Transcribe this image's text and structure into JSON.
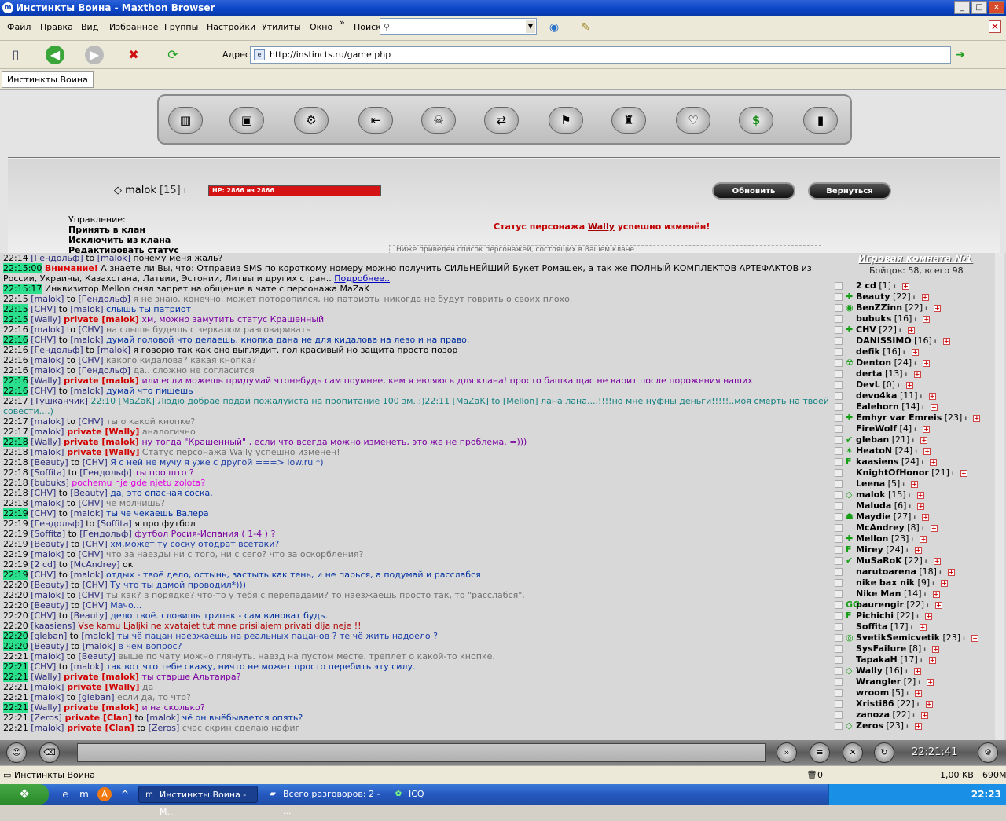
{
  "window": {
    "title": "Инстинкты Воина - Maxthon Browser",
    "buttons": [
      "_",
      "□",
      "×"
    ]
  },
  "menu": {
    "items": [
      "Файл",
      "Правка",
      "Вид",
      "Избранное",
      "Группы",
      "Настройки",
      "Утилиты",
      "Окно"
    ],
    "more": "»",
    "search_label": "Поиск",
    "search_value": ""
  },
  "toolbar": {
    "address_label": "Адрес",
    "url": "http://instincts.ru/game.php"
  },
  "tabs": [
    {
      "label": "Инстинкты Воина"
    }
  ],
  "game": {
    "player_name": "malok",
    "player_level": "[15]",
    "hp_text": "HP: 2866 из 2866",
    "hp_fraction": 1.0,
    "refresh_button": "Обновить",
    "back_button": "Вернуться",
    "management": {
      "title": "Управление:",
      "items": [
        "Принять в клан",
        "Исключить из клана",
        "Редактировать статус"
      ]
    },
    "status": {
      "before": "Статус персонажа ",
      "name": "Wally",
      "after": " успешно изменён!"
    },
    "hint": "Ниже приведен список персонажей, состоящих в Вашем клане"
  },
  "chat": [
    {
      "t": "22:14",
      "hl": false,
      "nick": "[Гендольф]",
      "to": " to ",
      "target": "[malok]",
      "msg": " почему меня жаль?",
      "c": "m-dark"
    },
    {
      "t": "22:15:00",
      "hl": true,
      "warn": "Внимание!",
      "msg": " А знаете ли Вы, что: Отправив SMS по короткому номеру можно получить СИЛЬНЕЙШИЙ Букет Ромашек, а так же ПОЛНЫЙ КОМПЛЕКТОВ АРТЕФАКТОВ из России, Украины, Казахстана, Латвии, Эстонии, Литвы и других стран.. ",
      "link": "Подробнее..",
      "c": "m-dark",
      "wrap": true
    },
    {
      "t": "22:15:17",
      "hl": true,
      "msg": " Инквизитор Mellon снял запрет на общение в чате с персонажа MaZaK",
      "c": "m-dark"
    },
    {
      "t": "22:15",
      "hl": false,
      "nick": "[malok]",
      "to": " to ",
      "target": "[Гендольф]",
      "msg": " я не знаю, конечно. может поторопился, но патриоты никогда не будут говрить о своих плохо.",
      "c": "m-gray"
    },
    {
      "t": "22:15",
      "hl": true,
      "nick": "[CHV]",
      "to": " to ",
      "target": "[malok]",
      "msg": " слышь ты патриот",
      "c": "m-navy"
    },
    {
      "t": "22:15",
      "hl": true,
      "nick": "[Wally]",
      "priv": " private [malok]",
      "msg": " хм, можно замутить статус Крашенный",
      "c": "m-purple"
    },
    {
      "t": "22:16",
      "hl": false,
      "nick": "[malok]",
      "to": " to ",
      "target": "[CHV]",
      "msg": " на слышь будешь с зеркалом разговаривать",
      "c": "m-gray"
    },
    {
      "t": "22:16",
      "hl": true,
      "nick": "[CHV]",
      "to": " to ",
      "target": "[malok]",
      "msg": " думай головой что делаешь. кнопка дана не для кидалова на лево и на право.",
      "c": "m-navy"
    },
    {
      "t": "22:16",
      "hl": false,
      "nick": "[Гендольф]",
      "to": " to ",
      "target": "[malok]",
      "msg": " я говорю так как оно выглядит. гол красивый но защита просто позор",
      "c": "m-dark"
    },
    {
      "t": "22:16",
      "hl": false,
      "nick": "[malok]",
      "to": " to ",
      "target": "[CHV]",
      "msg": " какого кидалова? какая кнопка?",
      "c": "m-gray"
    },
    {
      "t": "22:16",
      "hl": false,
      "nick": "[malok]",
      "to": " to ",
      "target": "[Гендольф]",
      "msg": " да.. сложно не согласится",
      "c": "m-gray"
    },
    {
      "t": "22:16",
      "hl": true,
      "nick": "[Wally]",
      "priv": " private [malok]",
      "msg": " или если можешь придумай чтонебудь сам поумнее, кем я евляюсь для клана! просто башка щас не варит после порожения наших",
      "c": "m-purple"
    },
    {
      "t": "22:16",
      "hl": true,
      "nick": "[CHV]",
      "to": " to ",
      "target": "[malok]",
      "msg": " думай что пишешь",
      "c": "m-navy"
    },
    {
      "t": "22:17",
      "hl": false,
      "nick": "[Тушканчик]",
      "msg": " 22:10 [MaZaK] Людю добрае подай пожалуйста на пропитание 100 зм..:)22:11 [MaZaK] to [Mellon] лана лана....!!!!но мне нуфны деньги!!!!!..моя смерть на твоей совести....)",
      "c": "m-teal",
      "wrap": true
    },
    {
      "t": "22:17",
      "hl": false,
      "nick": "[malok]",
      "to": " to ",
      "target": "[CHV]",
      "msg": " ты о какой кнопке?",
      "c": "m-gray"
    },
    {
      "t": "22:17",
      "hl": false,
      "nick": "[malok]",
      "priv": " private [Wally]",
      "msg": " аналогично",
      "c": "m-gray"
    },
    {
      "t": "22:18",
      "hl": true,
      "nick": "[Wally]",
      "priv": " private [malok]",
      "msg": " ну тогда \"Крашенный\" , если что всегда можно изменеть, это же не проблема. =)))",
      "c": "m-purple"
    },
    {
      "t": "22:18",
      "hl": false,
      "nick": "[malok]",
      "priv": " private [Wally]",
      "msg": " Статус персонажа Wally успешно изменён!",
      "c": "m-gray"
    },
    {
      "t": "22:18",
      "hl": false,
      "nick": "[Beauty]",
      "to": " to ",
      "target": "[CHV]",
      "msg": " Я с ней не мучу я уже с другой ===> Iow.ru *)",
      "c": "m-blue"
    },
    {
      "t": "22:18",
      "hl": false,
      "nick": "[Soffita]",
      "to": " to ",
      "target": "[Гендольф]",
      "msg": " ты про што ?",
      "c": "m-purple"
    },
    {
      "t": "22:18",
      "hl": false,
      "nick": "[bubuks]",
      "msg": " pochemu nje gde njetu zolota?",
      "c": "m-magenta"
    },
    {
      "t": "22:18",
      "hl": false,
      "nick": "[CHV]",
      "to": " to ",
      "target": "[Beauty]",
      "msg": " да, это опасная соска.",
      "c": "m-navy"
    },
    {
      "t": "22:18",
      "hl": false,
      "nick": "[malok]",
      "to": " to ",
      "target": "[CHV]",
      "msg": " че молчишь?",
      "c": "m-gray"
    },
    {
      "t": "22:19",
      "hl": true,
      "nick": "[CHV]",
      "to": " to ",
      "target": "[malok]",
      "msg": " ты че чекаешь Валера",
      "c": "m-navy"
    },
    {
      "t": "22:19",
      "hl": false,
      "nick": "[Гендольф]",
      "to": " to ",
      "target": "[Soffita]",
      "msg": " я про футбол",
      "c": "m-dark"
    },
    {
      "t": "22:19",
      "hl": false,
      "nick": "[Soffita]",
      "to": " to ",
      "target": "[Гендольф]",
      "msg": " футбол Росия-Испания ( 1-4 ) ?",
      "c": "m-purple"
    },
    {
      "t": "22:19",
      "hl": false,
      "nick": "[Beauty]",
      "to": " to ",
      "target": "[CHV]",
      "msg": " хм,может ту соску отодрат всетаки?",
      "c": "m-blue"
    },
    {
      "t": "22:19",
      "hl": false,
      "nick": "[malok]",
      "to": " to ",
      "target": "[CHV]",
      "msg": " что за наезды ни с того, ни с сего? что за оскорбления?",
      "c": "m-gray"
    },
    {
      "t": "22:19",
      "hl": false,
      "nick": "[2 cd]",
      "to": " to ",
      "target": "[McAndrey]",
      "msg": " ок",
      "c": "m-dark"
    },
    {
      "t": "22:19",
      "hl": true,
      "nick": "[CHV]",
      "to": " to ",
      "target": "[malok]",
      "msg": " отдых - твоё дело, остынь, застыть как тень, и не парься, а подумай и расслабся",
      "c": "m-navy"
    },
    {
      "t": "22:20",
      "hl": false,
      "nick": "[Beauty]",
      "to": " to ",
      "target": "[CHV]",
      "msg": " Ту что ты дамой проводил*)))",
      "c": "m-blue"
    },
    {
      "t": "22:20",
      "hl": false,
      "nick": "[malok]",
      "to": " to ",
      "target": "[CHV]",
      "msg": " ты как? в порядке? что-то у тебя с перепадами? то наезжаешь просто так, то \"расслабся\".",
      "c": "m-gray"
    },
    {
      "t": "22:20",
      "hl": false,
      "nick": "[Beauty]",
      "to": " to ",
      "target": "[CHV]",
      "msg": " Мачо...",
      "c": "m-blue"
    },
    {
      "t": "22:20",
      "hl": false,
      "nick": "[CHV]",
      "to": " to ",
      "target": "[Beauty]",
      "msg": " дело твоё. словишь трипак - сам виноват будь.",
      "c": "m-navy"
    },
    {
      "t": "22:20",
      "hl": false,
      "nick": "[kaasiens]",
      "msg": " Vse kamu Ljaljki ne xvatajet tut mne prisilajem privati dlja neje !!",
      "c": "m-red"
    },
    {
      "t": "22:20",
      "hl": true,
      "nick": "[gleban]",
      "to": " to ",
      "target": "[malok]",
      "msg": " ты чё пацан наезжаешь на реальных пацанов ? те чё жить надоело ?",
      "c": "m-blue"
    },
    {
      "t": "22:20",
      "hl": true,
      "nick": "[Beauty]",
      "to": " to ",
      "target": "[malok]",
      "msg": " в чем вопрос?",
      "c": "m-blue"
    },
    {
      "t": "22:21",
      "hl": false,
      "nick": "[malok]",
      "to": " to ",
      "target": "[Beauty]",
      "msg": " выше по чату можно глянуть. наезд на пустом месте. треплет о какой-то кнопке.",
      "c": "m-gray"
    },
    {
      "t": "22:21",
      "hl": true,
      "nick": "[CHV]",
      "to": " to ",
      "target": "[malok]",
      "msg": " так вот что тебе скажу, ничто не может просто перебить эту силу.",
      "c": "m-navy"
    },
    {
      "t": "22:21",
      "hl": true,
      "nick": "[Wally]",
      "priv": " private [malok]",
      "msg": " ты старше Альтаира?",
      "c": "m-purple"
    },
    {
      "t": "22:21",
      "hl": false,
      "nick": "[malok]",
      "priv": " private [Wally]",
      "msg": " да",
      "c": "m-gray"
    },
    {
      "t": "22:21",
      "hl": false,
      "nick": "[malok]",
      "to": " to ",
      "target": "[gleban]",
      "msg": " если да, то что?",
      "c": "m-gray"
    },
    {
      "t": "22:21",
      "hl": true,
      "nick": "[Wally]",
      "priv": " private [malok]",
      "msg": " и на сколько?",
      "c": "m-purple"
    },
    {
      "t": "22:21",
      "hl": false,
      "nick": "[Zeros]",
      "priv": " private [Clan]",
      "to": " to ",
      "target": "[malok]",
      "msg": " чё он выёбывается опять?",
      "c": "m-navy"
    },
    {
      "t": "22:21",
      "hl": false,
      "nick": "[malok]",
      "priv": " private [Clan]",
      "to": " to ",
      "target": "[Zeros]",
      "msg": " счас скрин сделаю нафиг",
      "c": "m-gray"
    }
  ],
  "roster": {
    "title": "Игровая комната №1",
    "subtitle": "Бойцов: 58, всего 98",
    "players": [
      {
        "name": "2 cd",
        "lvl": "[1]",
        "badge": ""
      },
      {
        "name": "Beauty",
        "lvl": "[22]",
        "badge": "✚"
      },
      {
        "name": "BenZZinn",
        "lvl": "[22]",
        "badge": "◉"
      },
      {
        "name": "bubuks",
        "lvl": "[16]",
        "badge": ""
      },
      {
        "name": "CHV",
        "lvl": "[22]",
        "badge": "✚"
      },
      {
        "name": "DANISSIMO",
        "lvl": "[16]",
        "badge": ""
      },
      {
        "name": "defik",
        "lvl": "[16]",
        "badge": ""
      },
      {
        "name": "Denton",
        "lvl": "[24]",
        "badge": "☢"
      },
      {
        "name": "derta",
        "lvl": "[13]",
        "badge": ""
      },
      {
        "name": "DevL",
        "lvl": "[0]",
        "badge": ""
      },
      {
        "name": "devo4ka",
        "lvl": "[11]",
        "badge": ""
      },
      {
        "name": "Ealehorn",
        "lvl": "[14]",
        "badge": ""
      },
      {
        "name": "Emhyr var Emreis",
        "lvl": "[23]",
        "badge": "✚"
      },
      {
        "name": "FireWolf",
        "lvl": "[4]",
        "badge": ""
      },
      {
        "name": "gleban",
        "lvl": "[21]",
        "badge": "✔"
      },
      {
        "name": "HeatoN",
        "lvl": "[24]",
        "badge": "✶"
      },
      {
        "name": "kaasiens",
        "lvl": "[24]",
        "badge": "F"
      },
      {
        "name": "KnightOfHonor",
        "lvl": "[21]",
        "badge": ""
      },
      {
        "name": "Leena",
        "lvl": "[5]",
        "badge": ""
      },
      {
        "name": "malok",
        "lvl": "[15]",
        "badge": "◇"
      },
      {
        "name": "Maluda",
        "lvl": "[6]",
        "badge": ""
      },
      {
        "name": "Maydie",
        "lvl": "[27]",
        "badge": "☗"
      },
      {
        "name": "McAndrey",
        "lvl": "[8]",
        "badge": ""
      },
      {
        "name": "Mellon",
        "lvl": "[23]",
        "badge": "✚"
      },
      {
        "name": "Mirey",
        "lvl": "[24]",
        "badge": "F"
      },
      {
        "name": "MuSaRoK",
        "lvl": "[22]",
        "badge": "✔"
      },
      {
        "name": "narutoarena",
        "lvl": "[18]",
        "badge": ""
      },
      {
        "name": "nike bax nik",
        "lvl": "[9]",
        "badge": ""
      },
      {
        "name": "Nike Man",
        "lvl": "[14]",
        "badge": ""
      },
      {
        "name": "paurengir",
        "lvl": "[22]",
        "badge": "GG"
      },
      {
        "name": "Pichichi",
        "lvl": "[22]",
        "badge": "F"
      },
      {
        "name": "Soffita",
        "lvl": "[17]",
        "badge": ""
      },
      {
        "name": "SvetikSemicvetik",
        "lvl": "[23]",
        "badge": "◎"
      },
      {
        "name": "SysFailure",
        "lvl": "[8]",
        "badge": ""
      },
      {
        "name": "TapakaH",
        "lvl": "[17]",
        "badge": ""
      },
      {
        "name": "Wally",
        "lvl": "[16]",
        "badge": "◇"
      },
      {
        "name": "Wrangler",
        "lvl": "[2]",
        "badge": ""
      },
      {
        "name": "wroom",
        "lvl": "[5]",
        "badge": ""
      },
      {
        "name": "Xristi86",
        "lvl": "[22]",
        "badge": ""
      },
      {
        "name": "zanoza",
        "lvl": "[22]",
        "badge": ""
      },
      {
        "name": "Zeros",
        "lvl": "[23]",
        "badge": "◇"
      }
    ]
  },
  "bottom": {
    "clock": "22:21:41"
  },
  "statusbar": {
    "text": "Инстинкты Воина",
    "count": "0",
    "size": "1,00 KB",
    "mem": "690M"
  },
  "taskbar": {
    "tasks": [
      "Инстинкты Воина - М...",
      "Всего разговоров: 2 - ...",
      "ICQ"
    ],
    "clock": "22:23"
  }
}
